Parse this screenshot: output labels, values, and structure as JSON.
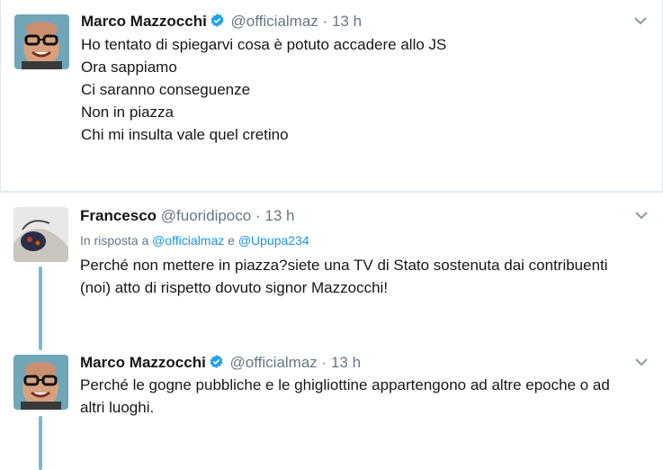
{
  "tweets": [
    {
      "name": "Marco Mazzocchi",
      "handle": "@officialmaz",
      "dot": "·",
      "time": "13 h",
      "lines": [
        "Ho tentato di spiegarvi cosa è potuto accadere allo JS",
        "Ora sappiamo",
        "Ci saranno conseguenze",
        "Non in piazza",
        "Chi mi insulta vale quel cretino"
      ]
    },
    {
      "name": "Francesco",
      "handle": "@fuoridipoco",
      "dot": "·",
      "time": "13 h",
      "reply_prefix": "In risposta a",
      "reply_user1": "@officialmaz",
      "reply_and": "e",
      "reply_user2": "@Upupa234",
      "text": "Perché non mettere in piazza?siete una TV di Stato sostenuta dai contribuenti (noi) atto di rispetto dovuto signor Mazzocchi!"
    },
    {
      "name": "Marco Mazzocchi",
      "handle": "@officialmaz",
      "dot": "·",
      "time": "13 h",
      "text": "Perché le gogne pubbliche e le ghigliottine appartengono ad altre epoche o ad altri luoghi."
    }
  ],
  "colors": {
    "verified": "#1da1f2",
    "link": "#1b95e0",
    "thread_line": "#78b9d3",
    "muted": "#657786"
  },
  "icons": {
    "verified": "verified-badge-icon",
    "chevron": "chevron-down-icon"
  }
}
